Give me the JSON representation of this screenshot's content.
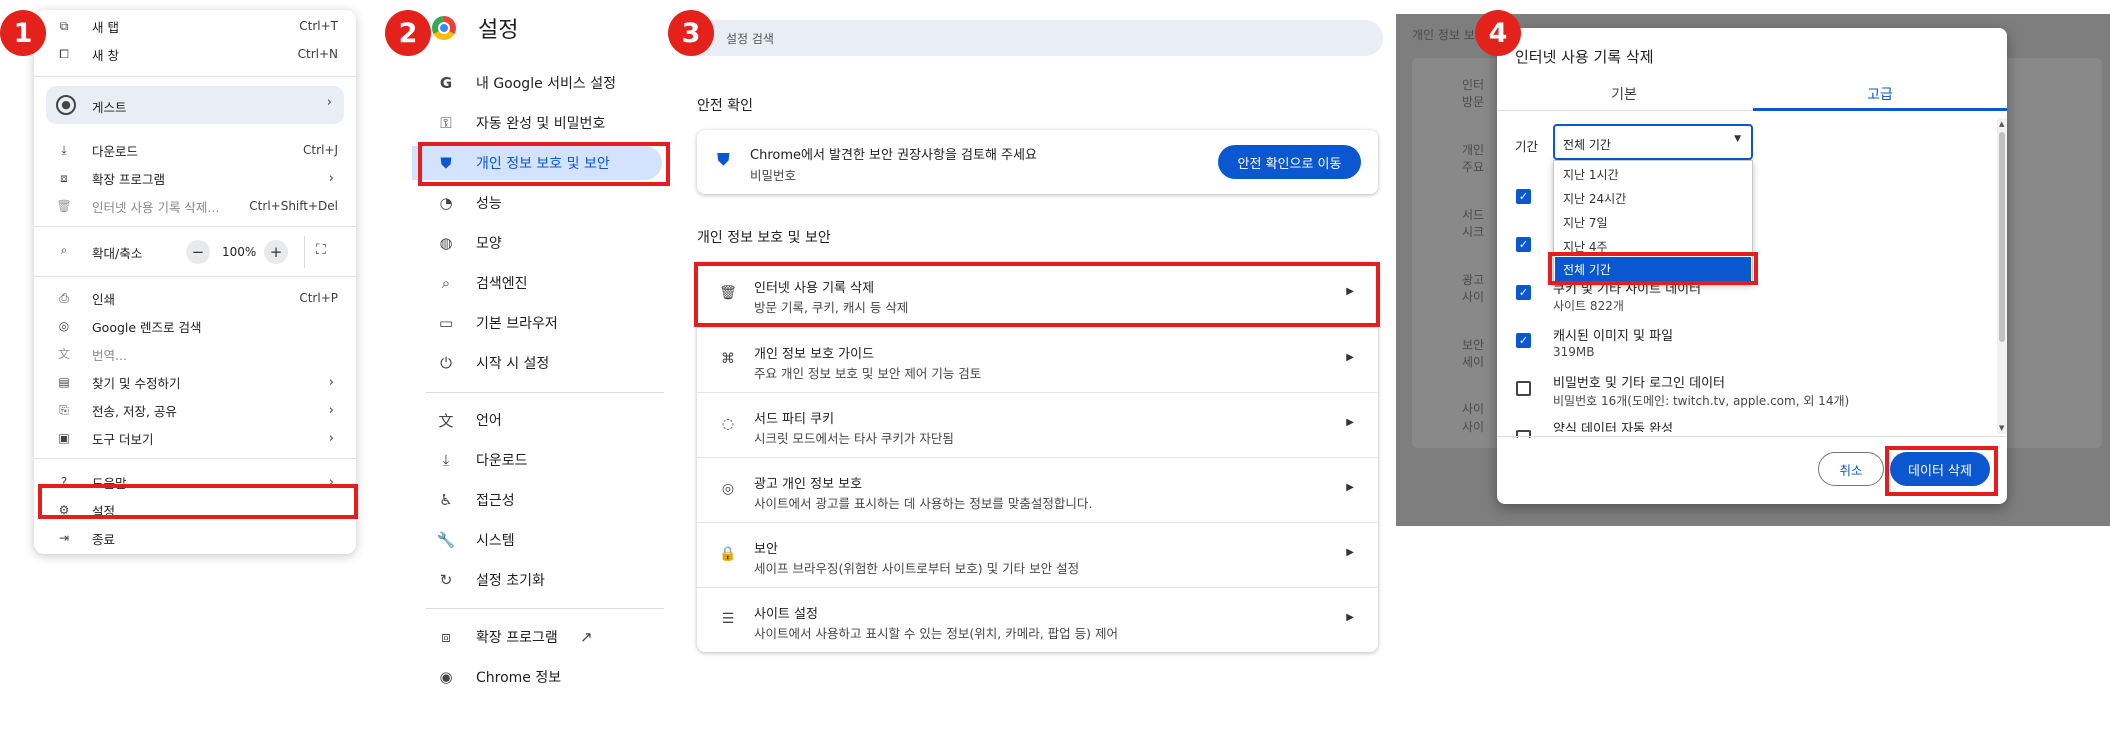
{
  "steps": [
    "1",
    "2",
    "3",
    "4"
  ],
  "menu": {
    "items": [
      {
        "label": "새 탭",
        "shortcut": "Ctrl+T",
        "icon": "new-tab-icon"
      },
      {
        "label": "새 창",
        "shortcut": "Ctrl+N",
        "icon": "new-window-icon"
      },
      {
        "label": "게스트",
        "icon": "guest-profile-icon"
      },
      {
        "label": "다운로드",
        "shortcut": "Ctrl+J",
        "icon": "download-icon"
      },
      {
        "label": "확장 프로그램",
        "icon": "extensions-icon"
      },
      {
        "label": "인터넷 사용 기록 삭제...",
        "shortcut": "Ctrl+Shift+Del",
        "icon": "trash-icon"
      },
      {
        "label": "확대/축소",
        "zoom": "100%",
        "minus": "−",
        "plus": "+",
        "icon": "zoom-icon"
      },
      {
        "label": "인쇄",
        "shortcut": "Ctrl+P",
        "icon": "print-icon"
      },
      {
        "label": "Google 렌즈로 검색",
        "icon": "lens-icon"
      },
      {
        "label": "번역...",
        "icon": "translate-icon"
      },
      {
        "label": "찾기 및 수정하기",
        "icon": "find-icon"
      },
      {
        "label": "전송, 저장, 공유",
        "icon": "share-icon"
      },
      {
        "label": "도구 더보기",
        "icon": "toolbox-icon"
      },
      {
        "label": "도움말",
        "icon": "help-icon"
      },
      {
        "label": "설정",
        "icon": "gear-icon"
      },
      {
        "label": "종료",
        "icon": "exit-icon"
      }
    ]
  },
  "settings": {
    "title": "설정",
    "nav": [
      {
        "label": "내 Google 서비스 설정",
        "icon": "google-icon"
      },
      {
        "label": "자동 완성 및 비밀번호",
        "icon": "key-icon"
      },
      {
        "label": "개인 정보 보호 및 보안",
        "icon": "shield-icon"
      },
      {
        "label": "성능",
        "icon": "gauge-icon"
      },
      {
        "label": "모양",
        "icon": "palette-icon"
      },
      {
        "label": "검색엔진",
        "icon": "search-icon"
      },
      {
        "label": "기본 브라우저",
        "icon": "browser-icon"
      },
      {
        "label": "시작 시 설정",
        "icon": "power-icon"
      },
      {
        "label": "언어",
        "icon": "language-icon"
      },
      {
        "label": "다운로드",
        "icon": "download-icon"
      },
      {
        "label": "접근성",
        "icon": "accessibility-icon"
      },
      {
        "label": "시스템",
        "icon": "wrench-icon"
      },
      {
        "label": "설정 초기화",
        "icon": "reset-icon"
      },
      {
        "label": "확장 프로그램",
        "icon": "extensions-icon"
      },
      {
        "label": "Chrome 정보",
        "icon": "chrome-icon"
      }
    ]
  },
  "privacy": {
    "search_placeholder": "설정 검색",
    "safety_heading": "안전 확인",
    "safety_title": "Chrome에서 발견한 보안 권장사항을 검토해 주세요",
    "safety_sub": "비밀번호",
    "safety_button": "안전 확인으로 이동",
    "section_heading": "개인 정보 보호 및 보안",
    "rows": [
      {
        "title": "인터넷 사용 기록 삭제",
        "sub": "방문 기록, 쿠키, 캐시 등 삭제",
        "icon": "trash-icon"
      },
      {
        "title": "개인 정보 보호 가이드",
        "sub": "주요 개인 정보 보호 및 보안 제어 기능 검토",
        "icon": "guide-icon"
      },
      {
        "title": "서드 파티 쿠키",
        "sub": "시크릿 모드에서는 타사 쿠키가 자단됨",
        "icon": "cookie-icon"
      },
      {
        "title": "광고 개인 정보 보호",
        "sub": "사이트에서 광고를 표시하는 데 사용하는 정보를 맞춤설정합니다.",
        "icon": "ad-privacy-icon"
      },
      {
        "title": "보안",
        "sub": "세이프 브라우징(위험한 사이트로부터 보호) 및 기타 보안 설정",
        "icon": "lock-icon"
      },
      {
        "title": "사이트 설정",
        "sub": "사이트에서 사용하고 표시할 수 있는 정보(위치, 카메라, 팝업 등) 제어",
        "icon": "sliders-icon"
      }
    ]
  },
  "dialog": {
    "bg_heading": "개인 정보 보",
    "bg_texts": [
      "인터",
      "방문",
      "개인",
      "주요",
      "서드",
      "시크",
      "광고",
      "사이",
      "보안",
      "세이",
      "사이",
      "사이"
    ],
    "title": "인터넷 사용 기록 삭제",
    "tabs": [
      "기본",
      "고급"
    ],
    "period_label": "기간",
    "period_value": "전체 기간",
    "options": [
      "지난 1시간",
      "지난 24시간",
      "지난 7일",
      "지난 4주",
      "전체 기간"
    ],
    "items": [
      {
        "title": "",
        "sub": "",
        "checked": true
      },
      {
        "title": "",
        "sub": "",
        "checked": true
      },
      {
        "title": "쿠키 및 기타 사이트 데이터",
        "sub": "사이트 822개",
        "checked": true
      },
      {
        "title": "캐시된 이미지 및 파일",
        "sub": "319MB",
        "checked": true
      },
      {
        "title": "비밀번호 및 기타 로그인 데이터",
        "sub": "비밀번호 16개(도메인: twitch.tv, apple.com, 외 14개)",
        "checked": false
      },
      {
        "title": "양식 데이터 자동 완성",
        "sub": "",
        "checked": false
      }
    ],
    "cancel": "취소",
    "delete": "데이터 삭제"
  }
}
